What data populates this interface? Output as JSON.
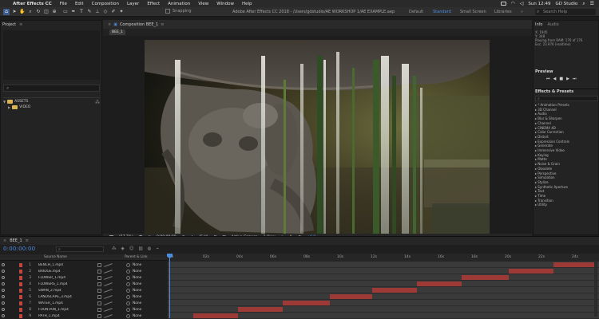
{
  "menubar": {
    "app": "After Effects CC",
    "items": [
      "File",
      "Edit",
      "Composition",
      "Layer",
      "Effect",
      "Animation",
      "View",
      "Window",
      "Help"
    ],
    "clock": "Sun 12:49",
    "user": "GD Studio"
  },
  "toolbar": {
    "snapping": "Snapping",
    "title": "Adobe After Effects CC 2018 - /Users/gdstudio/AE WORKSHOP 1/AE EXAMPLE.aep",
    "workspaces": [
      "Default",
      "Standard",
      "Small Screen",
      "Libraries"
    ],
    "active_workspace": "Standard",
    "search_placeholder": "Search Help"
  },
  "project": {
    "title": "Project",
    "search": "⌕",
    "items": [
      {
        "name": "ASSETS",
        "type": "folder",
        "expanded": true
      },
      {
        "name": "VIDEO",
        "type": "folder",
        "expanded": false
      }
    ],
    "footer": "8 bpc"
  },
  "composition": {
    "tab": "Composition BEE_1",
    "subtab": "BEE_1",
    "zoom": "(57.7%)",
    "timecode": "0:00:00:00",
    "resolution": "(Full)",
    "camera": "Active Camera",
    "views": "1 View",
    "exposure": "+0.0"
  },
  "rightpanel": {
    "info_tab": "Info",
    "audio_tab": "Audio",
    "info_lines": [
      "X: 1945",
      "Y: 348",
      "Playing from RAM: 176 of 176",
      "Exc. 23.976 (realtime)"
    ],
    "preview_tab": "Preview",
    "effects_tab": "Effects & Presets",
    "effects": [
      "* Animation Presets",
      "3D Channel",
      "Audio",
      "Blur & Sharpen",
      "Channel",
      "CINEMA 4D",
      "Color Correction",
      "Distort",
      "Expression Controls",
      "Generate",
      "Immersive Video",
      "Keying",
      "Matte",
      "Noise & Grain",
      "Obsolete",
      "Perspective",
      "Simulation",
      "Stylize",
      "Synthetic Aperture",
      "Text",
      "Time",
      "Transition",
      "Utility"
    ]
  },
  "timeline": {
    "tab": "BEE_1",
    "timecode": "0:00:00:00",
    "col_source": "Source Name",
    "col_parent": "Parent & Link",
    "ruler": [
      "0s",
      "02s",
      "04s",
      "06s",
      "08s",
      "10s",
      "12s",
      "14s",
      "16s",
      "18s",
      "20s",
      "22s",
      "24s"
    ],
    "layers": [
      {
        "num": "1",
        "name": "BENCH_1.mp4",
        "parent": "None"
      },
      {
        "num": "2",
        "name": "BRIDGE.mp4",
        "parent": "None"
      },
      {
        "num": "3",
        "name": "FLOWER_1.mp4",
        "parent": "None"
      },
      {
        "num": "4",
        "name": "FLOWERS_1.mp4",
        "parent": "None"
      },
      {
        "num": "5",
        "name": "SWAN_2.mp4",
        "parent": "None"
      },
      {
        "num": "6",
        "name": "LANDSCAPE_3.mp4",
        "parent": "None"
      },
      {
        "num": "7",
        "name": "WATER_1.mp4",
        "parent": "None"
      },
      {
        "num": "8",
        "name": "FOUNTAIN_1.mp4",
        "parent": "None"
      },
      {
        "num": "9",
        "name": "PATH_1.mp4",
        "parent": "None"
      }
    ],
    "clips": [
      {
        "start": 0.905,
        "end": 1.0
      },
      {
        "start": 0.8,
        "end": 0.905
      },
      {
        "start": 0.69,
        "end": 0.8
      },
      {
        "start": 0.585,
        "end": 0.69
      },
      {
        "start": 0.48,
        "end": 0.585
      },
      {
        "start": 0.38,
        "end": 0.48
      },
      {
        "start": 0.27,
        "end": 0.38
      },
      {
        "start": 0.165,
        "end": 0.27
      },
      {
        "start": 0.06,
        "end": 0.165
      }
    ]
  }
}
